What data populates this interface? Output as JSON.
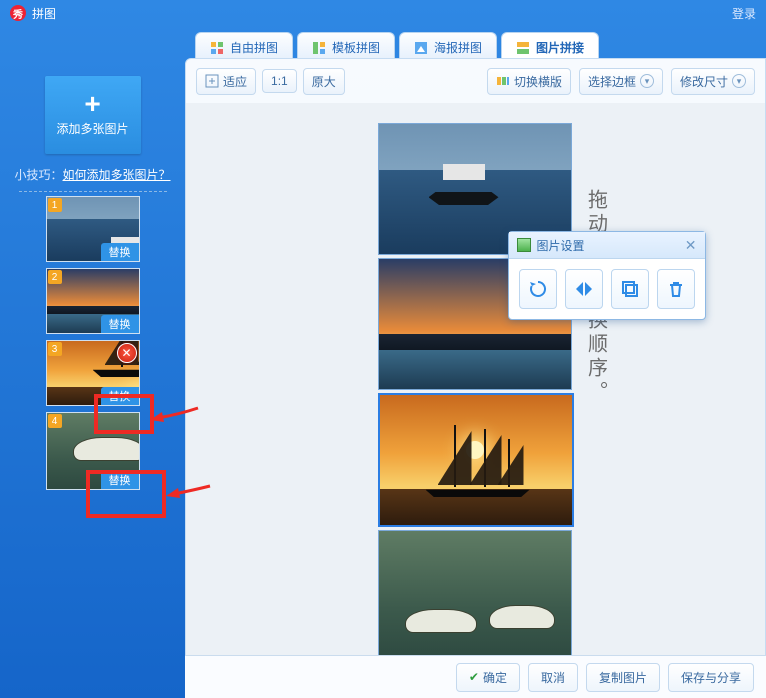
{
  "title": "拼图",
  "login": "登录",
  "tabs": [
    {
      "label": "自由拼图"
    },
    {
      "label": "模板拼图"
    },
    {
      "label": "海报拼图"
    },
    {
      "label": "图片拼接"
    }
  ],
  "toolbar": {
    "fit": "适应",
    "scale": "1:1",
    "original": "原大",
    "switch_layout": "切换横版",
    "choose_border": "选择边框",
    "resize": "修改尺寸"
  },
  "sidebar": {
    "add_label": "添加多张图片",
    "tip_prefix": "小技巧：",
    "tip_link": "如何添加多张图片？",
    "replace": "替换",
    "thumbs": [
      "1",
      "2",
      "3",
      "4"
    ]
  },
  "popup": {
    "title": "图片设置"
  },
  "vertical_text": "拖动图片更换顺序。",
  "footer": {
    "ok": "确定",
    "cancel": "取消",
    "copy": "复制图片",
    "save": "保存与分享"
  }
}
